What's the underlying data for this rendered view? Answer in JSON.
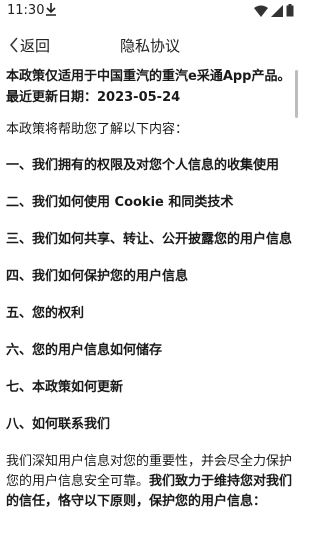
{
  "status_bar": {
    "time": "11:30",
    "icons": [
      "download-icon",
      "wifi-icon",
      "signal-icon",
      "battery-icon"
    ]
  },
  "nav": {
    "back_label": "返回",
    "title": "隐私协议",
    "back_icon": "chevron-left-icon"
  },
  "intro": {
    "applies_to": "本政策仅适用于中国重汽的重汽e采通App产品。",
    "last_updated": "最近更新日期：2023-05-24"
  },
  "lead": "本政策将帮助您了解以下内容：",
  "sections": [
    "一、我们拥有的权限及对您个人信息的收集使用",
    "二、我们如何使用 Cookie 和同类技术",
    "三、我们如何共享、转让、公开披露您的用户信息",
    "四、我们如何保护您的用户信息",
    "五、您的权利",
    "六、您的用户信息如何储存",
    "七、本政策如何更新",
    "八、如何联系我们"
  ],
  "body": {
    "normal": "我们深知用户信息对您的重要性，并会尽全力保护您的用户信息安全可靠。",
    "emphasis": "我们致力于维持您对我们的信任，恪守以下原则，保护您的用户信息："
  }
}
